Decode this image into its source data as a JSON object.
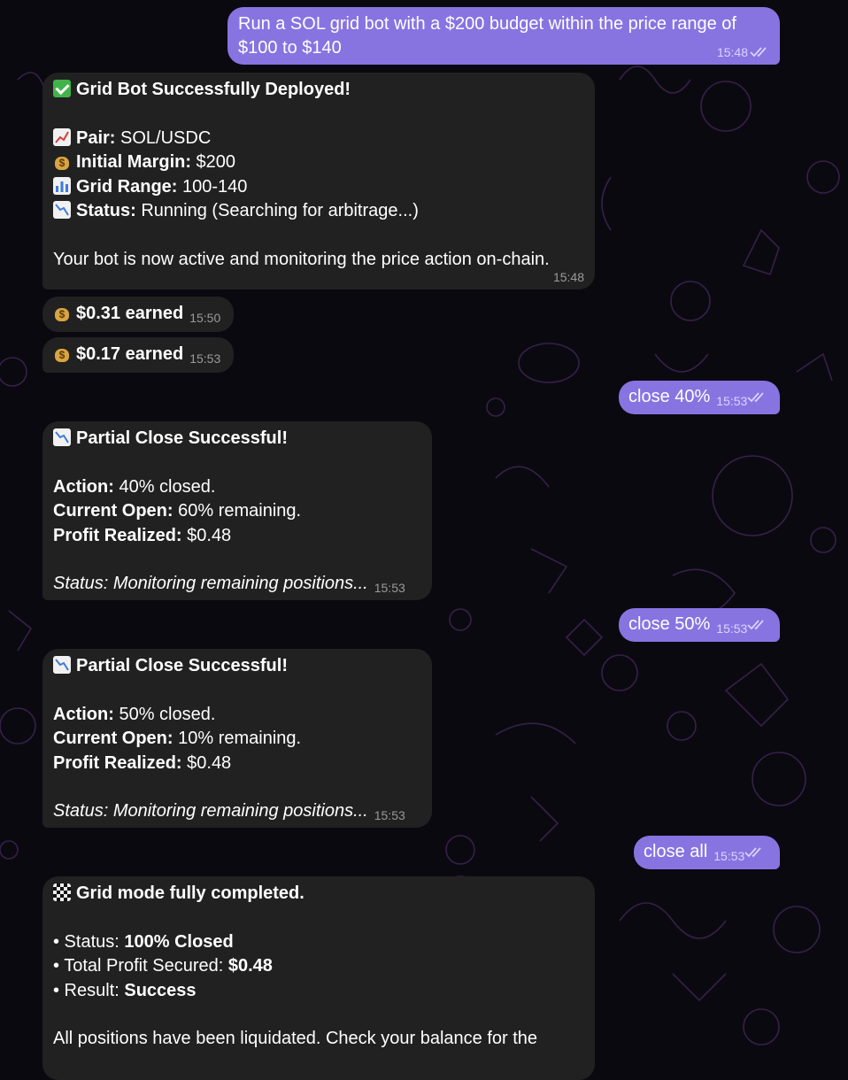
{
  "messages": [
    {
      "dir": "out",
      "lines": [
        "Run a SOL grid bot with a $200 budget within the price range of",
        "$100 to $140"
      ],
      "time": "15:48",
      "read": true
    },
    {
      "dir": "in",
      "title_icon": "check-mark-emoji",
      "title": "Grid Bot Successfully Deployed!",
      "fields": [
        {
          "icon": "chart-increasing-emoji",
          "label": "Pair:",
          "value": " SOL/USDC"
        },
        {
          "icon": "money-bag-emoji",
          "label": "Initial Margin:",
          "value": " $200"
        },
        {
          "icon": "bar-chart-emoji",
          "label": "Grid Range:",
          "value": " 100-140"
        },
        {
          "icon": "chart-decreasing-emoji",
          "label": "Status:",
          "value": " Running (Searching for arbitrage...)"
        }
      ],
      "body": "Your bot is now active and monitoring the price action on-chain.",
      "time": "15:48"
    },
    {
      "dir": "in",
      "icon": "money-bag-emoji",
      "text": "$0.31 earned",
      "time": "15:50"
    },
    {
      "dir": "in",
      "icon": "money-bag-emoji",
      "text": "$0.17 earned",
      "time": "15:53"
    },
    {
      "dir": "out",
      "text": "close 40%",
      "time": "15:53",
      "read": true
    },
    {
      "dir": "in",
      "title_icon": "chart-decreasing-emoji",
      "title": "Partial Close Successful!",
      "fields": [
        {
          "label": "Action:",
          "value": " 40% closed."
        },
        {
          "label": "Current Open:",
          "value": " 60% remaining."
        },
        {
          "label": "Profit Realized:",
          "value": " $0.48"
        }
      ],
      "status": "Status: Monitoring remaining positions...",
      "time": "15:53"
    },
    {
      "dir": "out",
      "text": "close 50%",
      "time": "15:53",
      "read": true
    },
    {
      "dir": "in",
      "title_icon": "chart-decreasing-emoji",
      "title": "Partial Close Successful!",
      "fields": [
        {
          "label": "Action:",
          "value": " 50% closed."
        },
        {
          "label": "Current Open:",
          "value": " 10% remaining."
        },
        {
          "label": "Profit Realized:",
          "value": " $0.48"
        }
      ],
      "status": "Status: Monitoring remaining positions...",
      "time": "15:53"
    },
    {
      "dir": "out",
      "text": "close all",
      "time": "15:53",
      "read": true
    },
    {
      "dir": "in",
      "title_icon": "chequered-flag-emoji",
      "title": "Grid mode fully completed.",
      "bullets": [
        {
          "prefix": "• Status: ",
          "value": "100% Closed"
        },
        {
          "prefix": "• Total Profit Secured: ",
          "value": "$0.48"
        },
        {
          "prefix": "• Result: ",
          "value": "Success"
        }
      ],
      "body": "All positions have been liquidated. Check your balance for the"
    }
  ],
  "colors": {
    "outgoing_bubble": "#8774e1",
    "incoming_bubble": "#212121",
    "background": "#0b0910",
    "pattern": "#3b2350"
  }
}
